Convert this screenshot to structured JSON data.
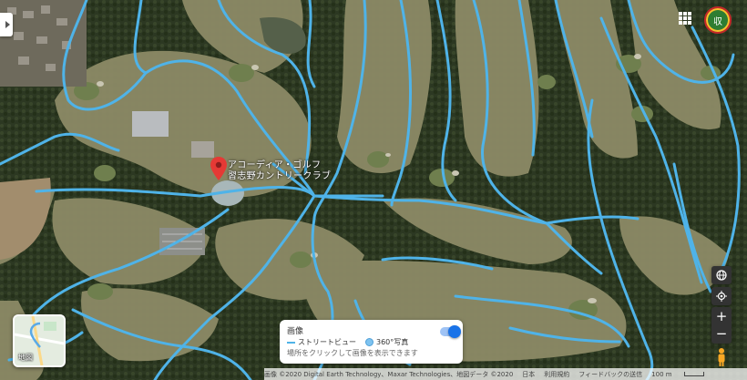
{
  "place": {
    "name_line1": "アコーディア・ゴルフ",
    "name_line2": "習志野カントリークラブ"
  },
  "user": {
    "avatar_label": "収"
  },
  "layers": {
    "tile_label": "地図"
  },
  "imagery_panel": {
    "title": "画像",
    "streetview_label": "ストリートビュー",
    "photo360_label": "360°写真",
    "hint": "場所をクリックして画像を表示できます",
    "toggle_on": true
  },
  "footer": {
    "imagery_credit": "画像 ©2020 Digital Earth Technology、Maxar Technologies、地図データ ©2020",
    "country": "日本",
    "terms": "利用規約",
    "feedback": "フィードバックの送信",
    "scale": "100 m"
  },
  "colors": {
    "streetview_line": "#4fb3e8",
    "pin": "#e53935",
    "fairway": "#7d8a5a",
    "forest": "#2f3a24"
  },
  "icons": {
    "side_toggle": "chevron-right-icon",
    "apps": "apps-grid-icon",
    "globe": "globe-icon",
    "locate": "my-location-icon",
    "pegman": "pegman-icon",
    "pin": "map-pin-icon"
  }
}
